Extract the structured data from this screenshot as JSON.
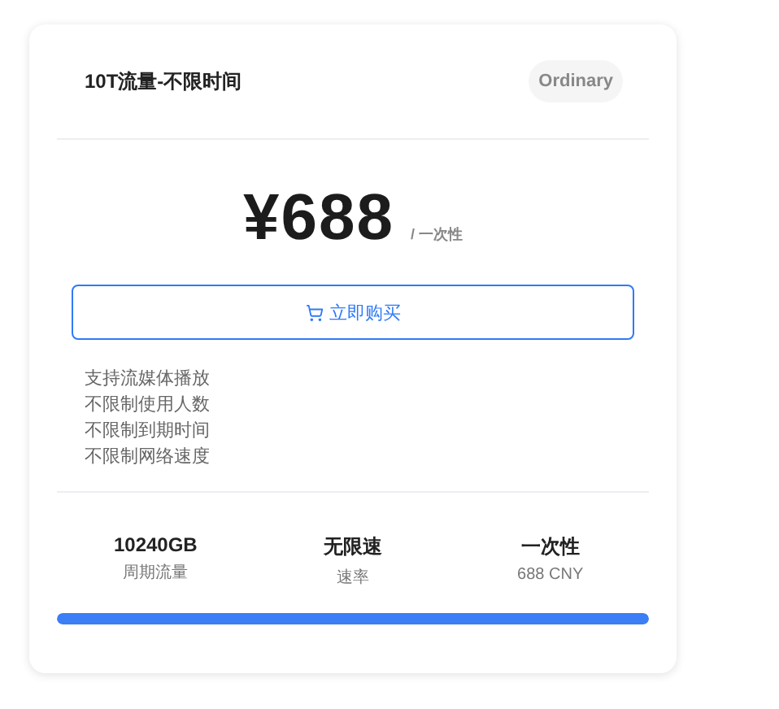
{
  "plan": {
    "title": "10T流量-不限时间",
    "badge": "Ordinary"
  },
  "price": {
    "amount": "¥688",
    "period": "/ 一次性"
  },
  "buy_button": {
    "label": "立即购买"
  },
  "features": [
    "支持流媒体播放",
    "不限制使用人数",
    "不限制到期时间",
    "不限制网络速度"
  ],
  "stats": [
    {
      "value": "10240GB",
      "label": "周期流量"
    },
    {
      "value": "无限速",
      "label": "速率"
    },
    {
      "value": "一次性",
      "label": "688 CNY"
    }
  ],
  "usage": {
    "level": 1
  }
}
